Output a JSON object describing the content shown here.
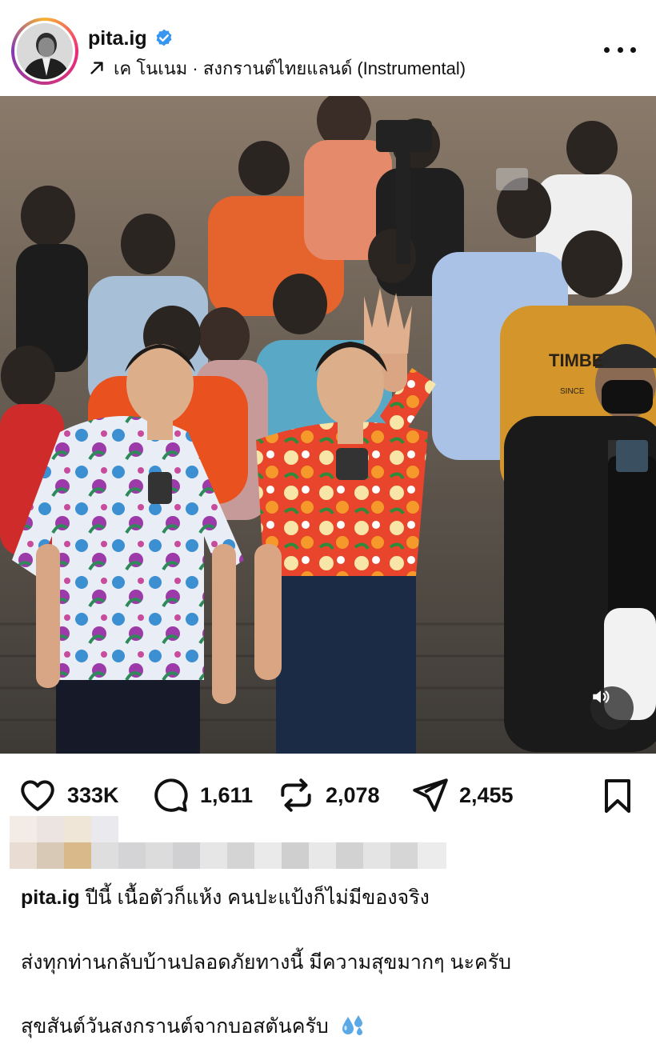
{
  "post": {
    "username": "pita.ig",
    "verified": true,
    "audio": "เค โนเนม · สงกรานต์ไทยแลนด์ (Instrumental)",
    "photo_alt": "",
    "shirt_text": "TIMBE",
    "shirt_small_text": "SINCE"
  },
  "actions": {
    "likes": "333K",
    "comments": "1,611",
    "reposts": "2,078",
    "shares": "2,455"
  },
  "caption": {
    "username": "pita.ig",
    "line1": "ปีนี้ เนื้อตัวก็แห้ง คนปะแป้งก็ไม่มีของจริง",
    "line2": "ส่งทุกท่านกลับบ้านปลอดภัยทางนี้ มีความสุขมากๆ นะครับ",
    "line3": "สุขสันต์วันสงกรานต์จากบอสตันครับ"
  },
  "icons": {
    "verified": "verified-badge-icon",
    "audio": "arrow-up-right-icon",
    "more": "more-dots-icon",
    "like": "heart-icon",
    "comment": "comment-bubble-icon",
    "repost": "repost-icon",
    "share": "send-icon",
    "save": "bookmark-icon",
    "sound": "speaker-icon",
    "emoji": "sweat-droplets-emoji"
  },
  "colors": {
    "verified_blue": "#3797f0",
    "text": "#111111"
  }
}
